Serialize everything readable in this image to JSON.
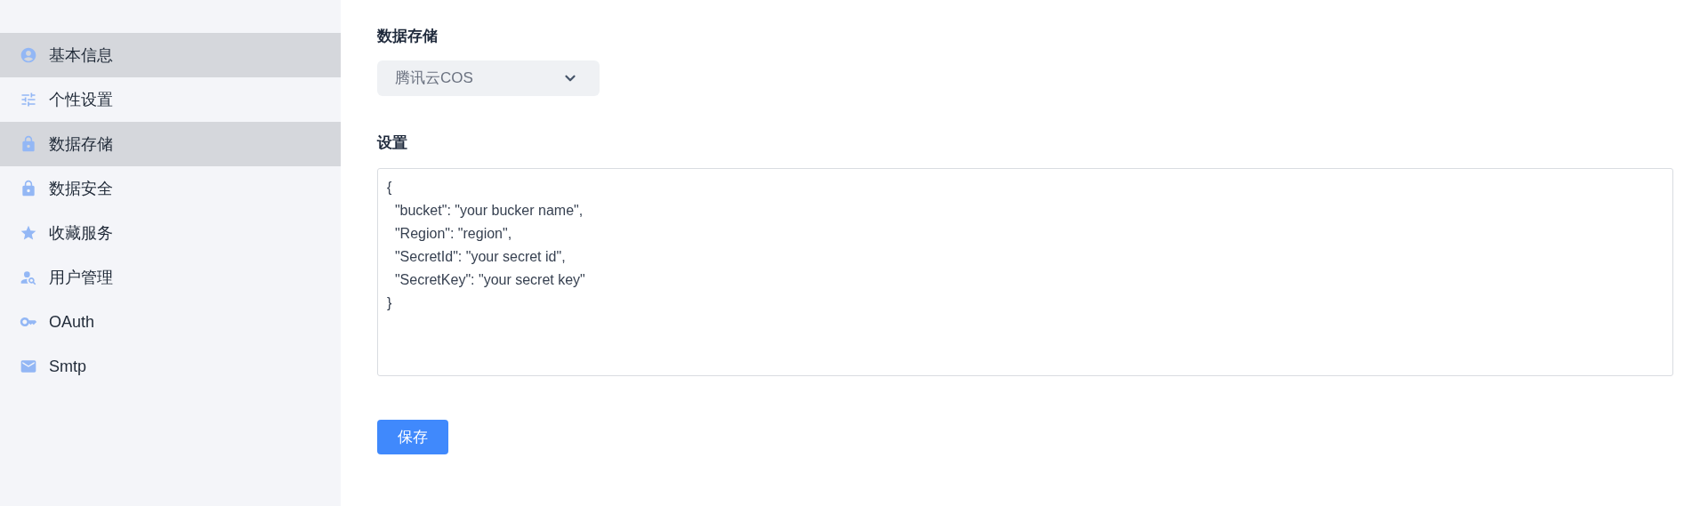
{
  "sidebar": {
    "items": [
      {
        "label": "基本信息",
        "selected": true
      },
      {
        "label": "个性设置",
        "selected": false
      },
      {
        "label": "数据存储",
        "selected": true
      },
      {
        "label": "数据安全",
        "selected": false
      },
      {
        "label": "收藏服务",
        "selected": false
      },
      {
        "label": "用户管理",
        "selected": false
      },
      {
        "label": "OAuth",
        "selected": false
      },
      {
        "label": "Smtp",
        "selected": false
      }
    ]
  },
  "storage": {
    "label": "数据存储",
    "select": {
      "value": "腾讯云COS"
    }
  },
  "settings": {
    "label": "设置",
    "value": "{\n  \"bucket\": \"your bucker name\",\n  \"Region\": \"region\",\n  \"SecretId\": \"your secret id\",\n  \"SecretKey\": \"your secret key\"\n}"
  },
  "save_button": "保存"
}
